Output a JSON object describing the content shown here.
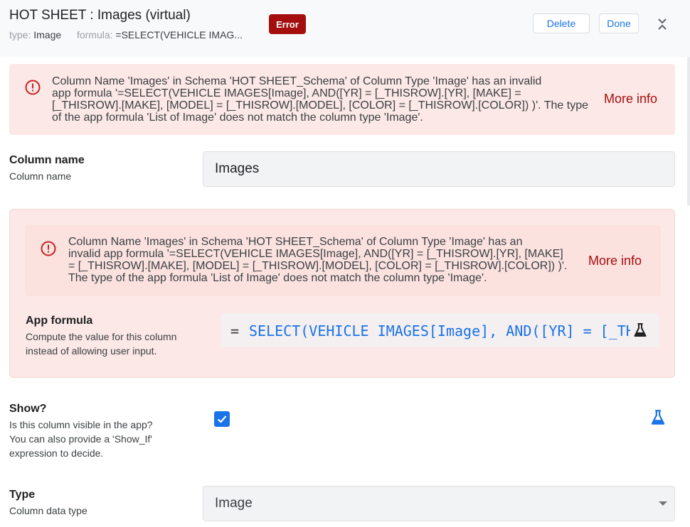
{
  "header": {
    "title": "HOT SHEET : Images (virtual)",
    "type_label": "type:",
    "type_value": "Image",
    "formula_label": "formula:",
    "formula_value": "=SELECT(VEHICLE IMAG...",
    "status_badge": "Error",
    "delete_label": "Delete",
    "done_label": "Done"
  },
  "top_error": {
    "line1": "Column Name 'Images' in Schema 'HOT SHEET_Schema' of Column Type 'Image' has an invalid",
    "line2": "app formula '=SELECT(VEHICLE IMAGES[Image], AND([YR] = [_THISROW].[YR], [MAKE] =",
    "line3": "[_THISROW].[MAKE], [MODEL] = [_THISROW].[MODEL], [COLOR] = [_THISROW].[COLOR]) )'. The type",
    "line4": "of the app formula 'List of Image' does not match the column type 'Image'.",
    "more_info": "More info"
  },
  "column_name": {
    "label": "Column name",
    "description": "Column name",
    "value": "Images"
  },
  "formula_section": {
    "error": {
      "line1": "Column Name 'Images' in Schema 'HOT SHEET_Schema' of Column Type 'Image' has an",
      "line2": "invalid app formula '=SELECT(VEHICLE IMAGES[Image], AND([YR] = [_THISROW].[YR], [MAKE]",
      "line3": "= [_THISROW].[MAKE], [MODEL] = [_THISROW].[MODEL], [COLOR] = [_THISROW].[COLOR]) )'.",
      "line4": "The type of the app formula 'List of Image' does not match the column type 'Image'.",
      "more_info": "More info"
    },
    "label": "App formula",
    "description_line1": "Compute the value for this column",
    "description_line2": "instead of allowing user input.",
    "eq_sign": "=",
    "formula": "SELECT(VEHICLE IMAGES[Image], AND([YR] = [_THISROW].[YR], [MAKE] = [_THISROW].[MAKE], [MODEL] = [_THISROW].[MODEL], [COLOR] = [_THISROW].[COLOR]) )"
  },
  "show": {
    "label": "Show?",
    "description_line1": "Is this column visible in the app?",
    "description_line2": "You can also provide a 'Show_If'",
    "description_line3": "expression to decide.",
    "checked": true
  },
  "type": {
    "label": "Type",
    "description": "Column data type",
    "value": "Image"
  },
  "colors": {
    "accent": "#1a73e8",
    "error": "#a50e0e",
    "error_bg": "#fce8e6"
  },
  "icons": [
    "error-circle-icon",
    "collapse-icon",
    "flask-icon",
    "check-icon",
    "dropdown-caret-icon"
  ]
}
